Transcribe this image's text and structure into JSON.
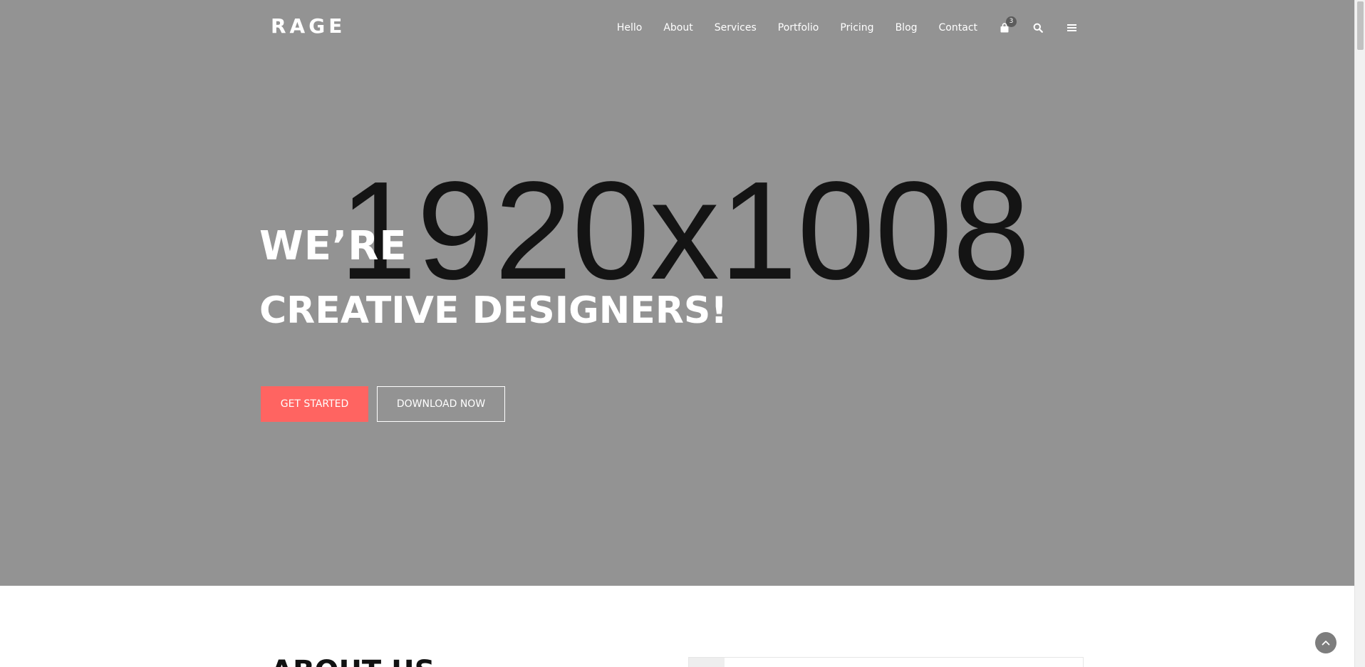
{
  "brand": {
    "logo": "RAGE"
  },
  "nav": {
    "links": [
      "Hello",
      "About",
      "Services",
      "Portfolio",
      "Pricing",
      "Blog",
      "Contact"
    ],
    "cart_count": "3",
    "icons": [
      "shopping-bag-icon",
      "search-icon",
      "menu-icon"
    ]
  },
  "hero": {
    "placeholder_text": "1920x1008",
    "title_line_1": "WE’RE",
    "title_line_2": "CREATIVE DESIGNERS!",
    "primary_button": "GET STARTED",
    "secondary_button": "DOWNLOAD NOW"
  },
  "about": {
    "title": "ABOUT US"
  },
  "colors": {
    "hero_background": "#939393",
    "accent": "#ff6461",
    "text_light": "#ffffff"
  }
}
